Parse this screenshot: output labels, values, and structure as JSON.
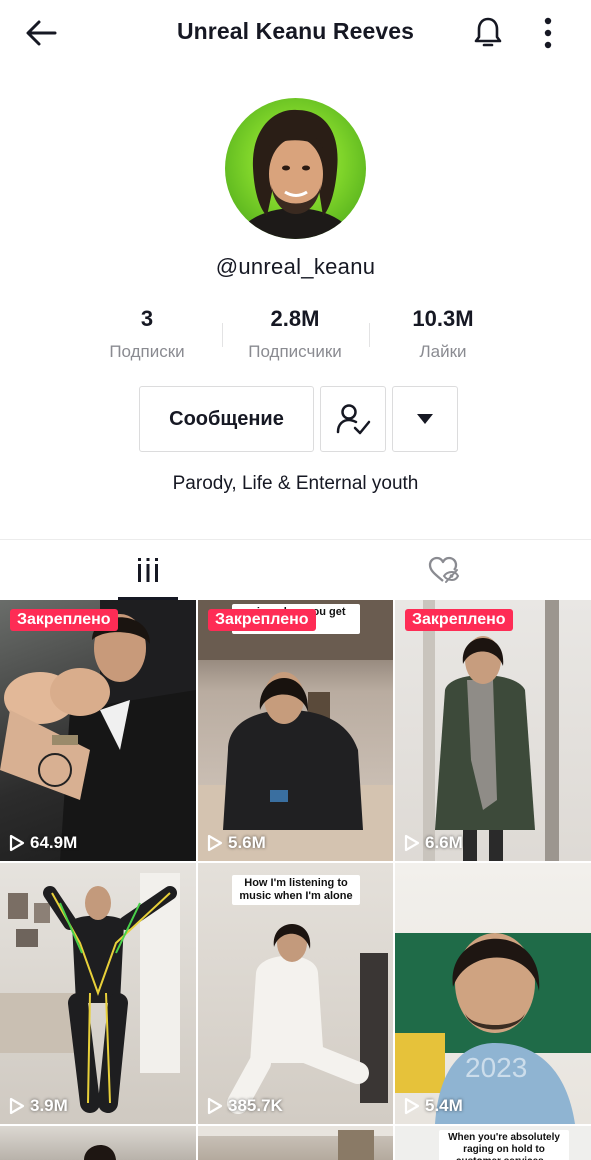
{
  "header": {
    "title": "Unreal Keanu Reeves",
    "back_icon": "arrow-left-icon",
    "notify_icon": "bell-icon",
    "more_icon": "more-vertical-icon"
  },
  "profile": {
    "username": "@unreal_keanu",
    "avatar_bg": "#7fd42a"
  },
  "stats": [
    {
      "value": "3",
      "label": "Подписки"
    },
    {
      "value": "2.8M",
      "label": "Подписчики"
    },
    {
      "value": "10.3M",
      "label": "Лайки"
    }
  ],
  "actions": {
    "message_label": "Сообщение",
    "friend_icon": "user-check-icon",
    "dropdown_icon": "caret-down-icon"
  },
  "bio": "Parody, Life & Enternal youth",
  "tabs": [
    {
      "icon": "grid-icon",
      "active": true
    },
    {
      "icon": "hidden-likes-icon",
      "active": false
    }
  ],
  "videos": [
    {
      "pinned_label": "Закреплено",
      "views": "64.9M",
      "caption": ""
    },
    {
      "pinned_label": "Закреплено",
      "views": "5.6M",
      "caption": "arise when you get old?"
    },
    {
      "pinned_label": "Закреплено",
      "views": "6.6M",
      "caption": ""
    },
    {
      "pinned_label": "",
      "views": "3.9M",
      "caption": ""
    },
    {
      "pinned_label": "",
      "views": "385.7K",
      "caption": "How I'm listening to music when I'm alone"
    },
    {
      "pinned_label": "",
      "views": "5.4M",
      "caption": "2023"
    },
    {
      "pinned_label": "",
      "views": "",
      "caption": ""
    },
    {
      "pinned_label": "",
      "views": "",
      "caption": ""
    },
    {
      "pinned_label": "",
      "views": "",
      "caption": "When you're absolutely raging on hold to customer services..."
    }
  ],
  "colors": {
    "accent": "#fe2c55",
    "text": "#161823",
    "muted": "#8a8b91"
  }
}
